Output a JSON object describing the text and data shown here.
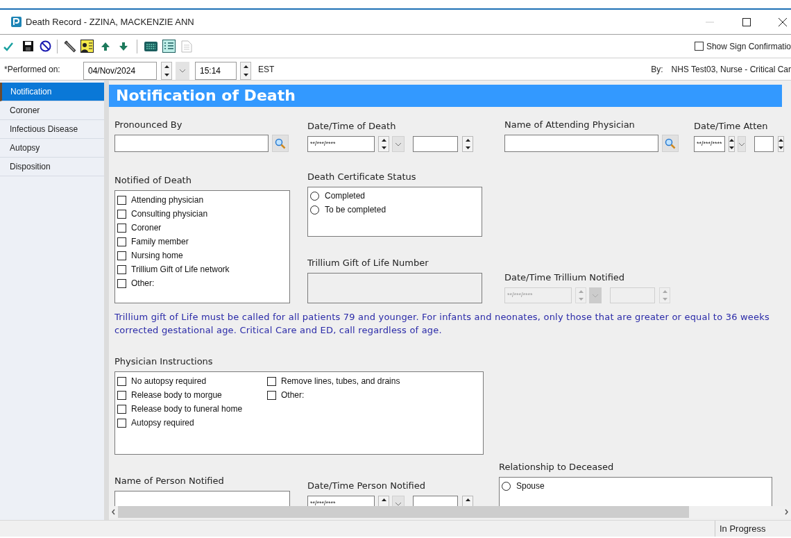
{
  "window": {
    "title": "Death Record - ZZINA, MACKENZIE ANN"
  },
  "show_sign_confirmation": {
    "label": "Show Sign Confirmatio",
    "checked": false
  },
  "performed": {
    "label": "*Performed on:",
    "date": "04/Nov/2024",
    "time": "15:14",
    "timezone": "EST",
    "by_label": "By:",
    "by_value": "NHS Test03, Nurse - Critical Car"
  },
  "sidebar": {
    "items": [
      {
        "label": "Notification",
        "selected": true
      },
      {
        "label": "Coroner",
        "selected": false
      },
      {
        "label": "Infectious Disease",
        "selected": false
      },
      {
        "label": "Autopsy",
        "selected": false
      },
      {
        "label": "Disposition",
        "selected": false
      }
    ]
  },
  "form": {
    "title": "Notification of Death",
    "rows": [
      {
        "columns": [
          [
            {
              "kind": "lookup",
              "label": "Pronounced By"
            }
          ],
          [
            {
              "kind": "datetime",
              "label": "Date/Time of Death",
              "mask": "**/***/****",
              "disabled": false
            }
          ],
          [
            {
              "kind": "lookup",
              "label": "Name of Attending Physician"
            }
          ],
          [
            {
              "kind": "datetime",
              "label": "Date/Time Atten",
              "mask": "**/***/****",
              "disabled": false
            }
          ]
        ]
      },
      {
        "columns": [
          [
            {
              "kind": "checklist",
              "label": "Notified of Death",
              "item_columns": [
                [
                  {
                    "label": "Attending physician",
                    "checked": false
                  },
                  {
                    "label": "Consulting physician",
                    "checked": false
                  },
                  {
                    "label": "Coroner",
                    "checked": false
                  },
                  {
                    "label": "Family member",
                    "checked": false
                  },
                  {
                    "label": "Nursing home",
                    "checked": false
                  },
                  {
                    "label": "Trillium Gift of Life network",
                    "checked": false
                  },
                  {
                    "label": "Other:",
                    "checked": false
                  }
                ]
              ]
            }
          ],
          [
            {
              "kind": "radiolist",
              "label": "Death Certificate Status",
              "items": [
                {
                  "label": "Completed",
                  "selected": false
                },
                {
                  "label": "To be completed",
                  "selected": false
                }
              ]
            },
            {
              "kind": "text",
              "label": "Trillium Gift of Life Number",
              "disabled": true
            }
          ],
          [
            {
              "kind": "datetime",
              "label": "Date/Time Trillium Notified",
              "mask": "**/***/****",
              "disabled": true
            }
          ]
        ]
      },
      {
        "columns": [
          [
            {
              "kind": "note",
              "text": "Trillium gift of Life must be called for all patients 79 and younger. For infants and neonates, only those that are greater or equal to 36 weeks corrected gestational age. Critical Care and ED, call regardless of age."
            }
          ]
        ]
      },
      {
        "columns": [
          [
            {
              "kind": "checklist",
              "label": "Physician Instructions",
              "item_columns": [
                [
                  {
                    "label": "No autopsy required",
                    "checked": false
                  },
                  {
                    "label": "Release body to morgue",
                    "checked": false
                  },
                  {
                    "label": "Release body to funeral home",
                    "checked": false
                  },
                  {
                    "label": "Autopsy required",
                    "checked": false
                  }
                ],
                [
                  {
                    "label": "Remove lines, tubes, and drains",
                    "checked": false
                  },
                  {
                    "label": "Other:",
                    "checked": false
                  }
                ]
              ]
            }
          ]
        ]
      },
      {
        "columns": [
          [
            {
              "kind": "text",
              "label": "Name of Person Notified",
              "disabled": false
            }
          ],
          [
            {
              "kind": "datetime",
              "label": "Date/Time Person Notified",
              "mask": "**/***/****",
              "disabled": false
            }
          ],
          [
            {
              "kind": "radiolist",
              "label": "Relationship to Deceased",
              "items": [
                {
                  "label": "Spouse",
                  "selected": false
                }
              ]
            }
          ]
        ]
      }
    ]
  },
  "status_bar": {
    "status": "In Progress"
  }
}
